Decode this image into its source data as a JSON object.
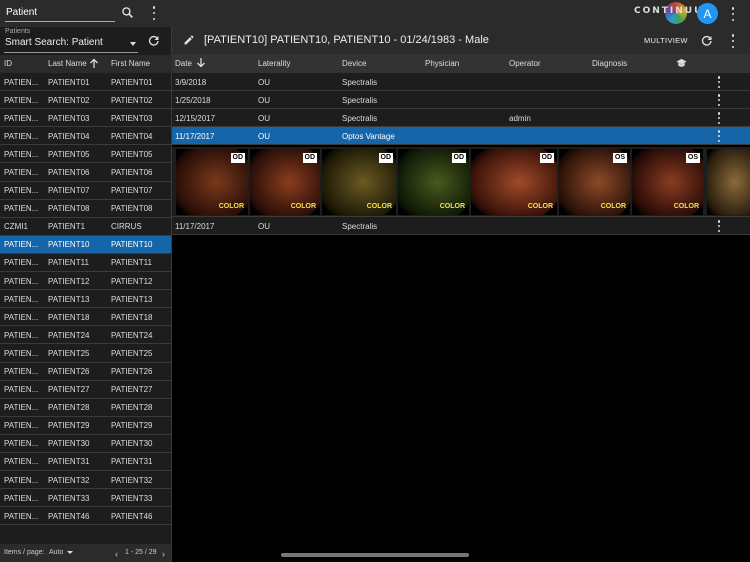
{
  "search": {
    "value": "Patient",
    "placeholder": "Patient"
  },
  "patients_label": "Patients",
  "smart_search": "Smart Search: Patient",
  "left_columns": {
    "id": "ID",
    "last": "Last Name",
    "first": "First Name"
  },
  "patients": [
    {
      "id": "PATIEN...",
      "last": "PATIENT01",
      "first": "PATIENT01"
    },
    {
      "id": "PATIEN...",
      "last": "PATIENT02",
      "first": "PATIENT02"
    },
    {
      "id": "PATIEN...",
      "last": "PATIENT03",
      "first": "PATIENT03"
    },
    {
      "id": "PATIEN...",
      "last": "PATIENT04",
      "first": "PATIENT04"
    },
    {
      "id": "PATIEN...",
      "last": "PATIENT05",
      "first": "PATIENT05"
    },
    {
      "id": "PATIEN...",
      "last": "PATIENT06",
      "first": "PATIENT06"
    },
    {
      "id": "PATIEN...",
      "last": "PATIENT07",
      "first": "PATIENT07"
    },
    {
      "id": "PATIEN...",
      "last": "PATIENT08",
      "first": "PATIENT08"
    },
    {
      "id": "CZMI1",
      "last": "PATIENT1",
      "first": "CIRRUS"
    },
    {
      "id": "PATIEN...",
      "last": "PATIENT10",
      "first": "PATIENT10",
      "selected": true
    },
    {
      "id": "PATIEN...",
      "last": "PATIENT11",
      "first": "PATIENT11"
    },
    {
      "id": "PATIEN...",
      "last": "PATIENT12",
      "first": "PATIENT12"
    },
    {
      "id": "PATIEN...",
      "last": "PATIENT13",
      "first": "PATIENT13"
    },
    {
      "id": "PATIEN...",
      "last": "PATIENT18",
      "first": "PATIENT18"
    },
    {
      "id": "PATIEN...",
      "last": "PATIENT24",
      "first": "PATIENT24"
    },
    {
      "id": "PATIEN...",
      "last": "PATIENT25",
      "first": "PATIENT25"
    },
    {
      "id": "PATIEN...",
      "last": "PATIENT26",
      "first": "PATIENT26"
    },
    {
      "id": "PATIEN...",
      "last": "PATIENT27",
      "first": "PATIENT27"
    },
    {
      "id": "PATIEN...",
      "last": "PATIENT28",
      "first": "PATIENT28"
    },
    {
      "id": "PATIEN...",
      "last": "PATIENT29",
      "first": "PATIENT29"
    },
    {
      "id": "PATIEN...",
      "last": "PATIENT30",
      "first": "PATIENT30"
    },
    {
      "id": "PATIEN...",
      "last": "PATIENT31",
      "first": "PATIENT31"
    },
    {
      "id": "PATIEN...",
      "last": "PATIENT32",
      "first": "PATIENT32"
    },
    {
      "id": "PATIEN...",
      "last": "PATIENT33",
      "first": "PATIENT33"
    },
    {
      "id": "PATIEN...",
      "last": "PATIENT46",
      "first": "PATIENT46"
    }
  ],
  "footer": {
    "items_per_page_label": "Items / page:",
    "items_per_page": "Auto",
    "range": "1 - 25 / 29"
  },
  "brand": {
    "logo_text": "CONTINUUM",
    "avatar_letter": "A",
    "accent": "#2196f3",
    "selection": "#1565a8"
  },
  "patient_header": {
    "title": "[PATIENT10] PATIENT10, PATIENT10 - 01/24/1983 - Male",
    "multiview": "MULTIVIEW"
  },
  "exam_columns": {
    "date": "Date",
    "laterality": "Laterality",
    "device": "Device",
    "physician": "Physician",
    "operator": "Operator",
    "diagnosis": "Diagnosis"
  },
  "exams": [
    {
      "date": "3/9/2018",
      "laterality": "OU",
      "device": "Spectralis",
      "physician": "",
      "operator": "",
      "diagnosis": ""
    },
    {
      "date": "1/25/2018",
      "laterality": "OU",
      "device": "Spectralis",
      "physician": "",
      "operator": "",
      "diagnosis": ""
    },
    {
      "date": "12/15/2017",
      "laterality": "OU",
      "device": "Spectralis",
      "physician": "",
      "operator": "admin",
      "diagnosis": ""
    },
    {
      "date": "11/17/2017",
      "laterality": "OU",
      "device": "Optos Vantage",
      "physician": "",
      "operator": "",
      "diagnosis": "",
      "selected": true
    },
    {
      "date": "11/17/2017",
      "laterality": "OU",
      "device": "Spectralis",
      "physician": "",
      "operator": "",
      "diagnosis": ""
    }
  ],
  "thumbnails": [
    {
      "eye": "OD",
      "modality": "COLOR"
    },
    {
      "eye": "OD",
      "modality": "COLOR"
    },
    {
      "eye": "OD",
      "modality": "COLOR"
    },
    {
      "eye": "OD",
      "modality": "COLOR"
    },
    {
      "eye": "OD",
      "modality": "COLOR"
    },
    {
      "eye": "OS",
      "modality": "COLOR"
    },
    {
      "eye": "OS",
      "modality": "COLOR"
    },
    {
      "eye": "",
      "modality": ""
    }
  ],
  "icons": [
    "search-icon",
    "more-vert-icon",
    "refresh-icon",
    "edit-icon",
    "sort-arrow-icon",
    "graduation-cap-icon",
    "chevron-left-icon",
    "chevron-right-icon"
  ]
}
